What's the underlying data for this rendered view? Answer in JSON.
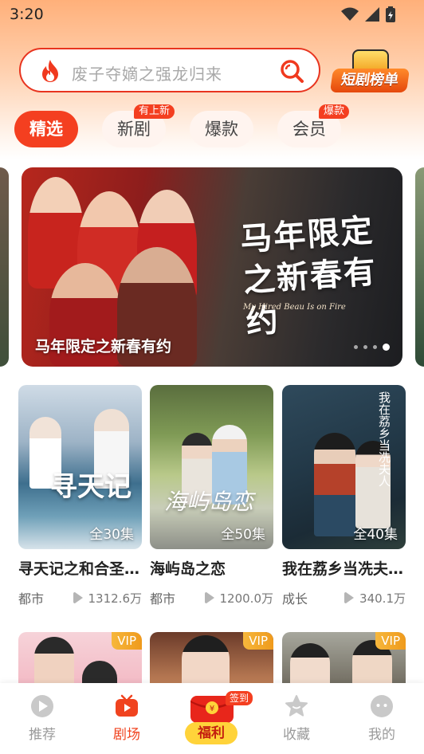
{
  "status_bar": {
    "time": "3:20"
  },
  "search": {
    "placeholder": "废子夺嫡之强龙归来"
  },
  "rank_badge": {
    "label": "短剧榜单"
  },
  "tabs": [
    {
      "label": "精选",
      "active": true
    },
    {
      "label": "新剧",
      "badge": "有上新"
    },
    {
      "label": "爆款"
    },
    {
      "label": "会员",
      "badge": "爆款"
    }
  ],
  "banner": {
    "title_art": "马年限定之新春有约",
    "subtitle_en": "My Hired Beau Is on Fire",
    "caption": "马年限定之新春有约",
    "page_count": 4,
    "active_page": 4
  },
  "cards": [
    {
      "title": "寻天记之和合圣…",
      "episodes": "全30集",
      "genre": "都市",
      "views": "1312.6万",
      "poster_text": "寻天记"
    },
    {
      "title": "海屿岛之恋",
      "episodes": "全50集",
      "genre": "都市",
      "views": "1200.0万",
      "poster_text": "海屿岛恋"
    },
    {
      "title": "我在荔乡当冼夫…",
      "episodes": "全40集",
      "genre": "成长",
      "views": "340.1万",
      "poster_text": "我在荔乡当冼夫人"
    }
  ],
  "vip_cards": [
    {
      "tag": "VIP"
    },
    {
      "tag": "VIP"
    },
    {
      "tag": "VIP"
    }
  ],
  "bottom_nav": [
    {
      "label": "推荐"
    },
    {
      "label": "剧场",
      "active": true
    },
    {
      "label": "福利",
      "badge": "签到"
    },
    {
      "label": "收藏"
    },
    {
      "label": "我的"
    }
  ],
  "colors": {
    "accent": "#f43f20",
    "vip": "#f2a72a",
    "welfare": "#ffd33a"
  }
}
